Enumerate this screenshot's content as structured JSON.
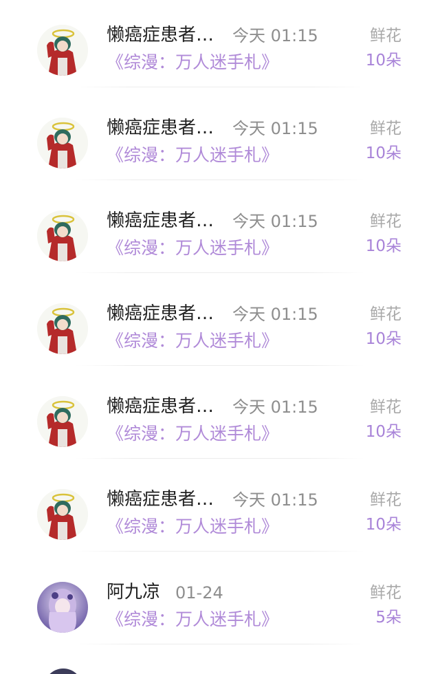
{
  "gift_list": {
    "items": [
      {
        "name": "懒癌症患者…",
        "time": "今天 01:15",
        "book": "《综漫：万人迷手札》",
        "gift_label": "鲜花",
        "gift_count": "10朵",
        "avatar": "red-coat-boy-avatar"
      },
      {
        "name": "懒癌症患者…",
        "time": "今天 01:15",
        "book": "《综漫：万人迷手札》",
        "gift_label": "鲜花",
        "gift_count": "10朵",
        "avatar": "red-coat-boy-avatar"
      },
      {
        "name": "懒癌症患者…",
        "time": "今天 01:15",
        "book": "《综漫：万人迷手札》",
        "gift_label": "鲜花",
        "gift_count": "10朵",
        "avatar": "red-coat-boy-avatar"
      },
      {
        "name": "懒癌症患者…",
        "time": "今天 01:15",
        "book": "《综漫：万人迷手札》",
        "gift_label": "鲜花",
        "gift_count": "10朵",
        "avatar": "red-coat-boy-avatar"
      },
      {
        "name": "懒癌症患者…",
        "time": "今天 01:15",
        "book": "《综漫：万人迷手札》",
        "gift_label": "鲜花",
        "gift_count": "10朵",
        "avatar": "red-coat-boy-avatar"
      },
      {
        "name": "懒癌症患者…",
        "time": "今天 01:15",
        "book": "《综漫：万人迷手札》",
        "gift_label": "鲜花",
        "gift_count": "10朵",
        "avatar": "red-coat-boy-avatar"
      },
      {
        "name": "阿九凉",
        "time": "01-24",
        "book": "《综漫：万人迷手札》",
        "gift_label": "鲜花",
        "gift_count": "5朵",
        "avatar": "purple-hair-girl-avatar"
      }
    ]
  },
  "colors": {
    "name": "#222222",
    "time": "#8e8e8e",
    "book": "#b08ad8",
    "gift_label": "#a9a9a9",
    "gift_count": "#a883d8"
  }
}
